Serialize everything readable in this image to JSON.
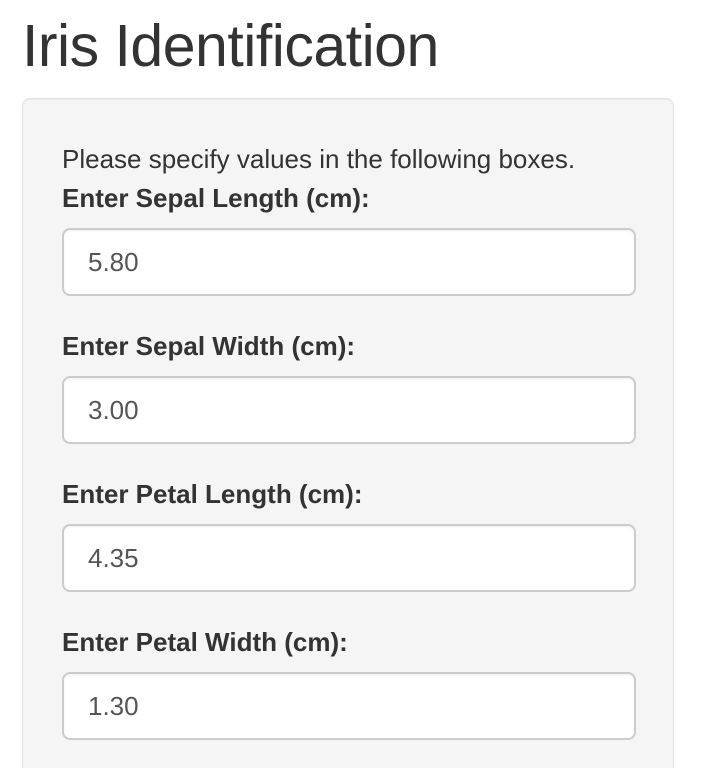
{
  "title": "Iris Identification",
  "form": {
    "help_text": "Please specify values in the following boxes.",
    "fields": [
      {
        "label": "Enter Sepal Length (cm):",
        "value": "5.80"
      },
      {
        "label": "Enter Sepal Width (cm):",
        "value": "3.00"
      },
      {
        "label": "Enter Petal Length (cm):",
        "value": "4.35"
      },
      {
        "label": "Enter Petal Width (cm):",
        "value": "1.30"
      }
    ]
  }
}
